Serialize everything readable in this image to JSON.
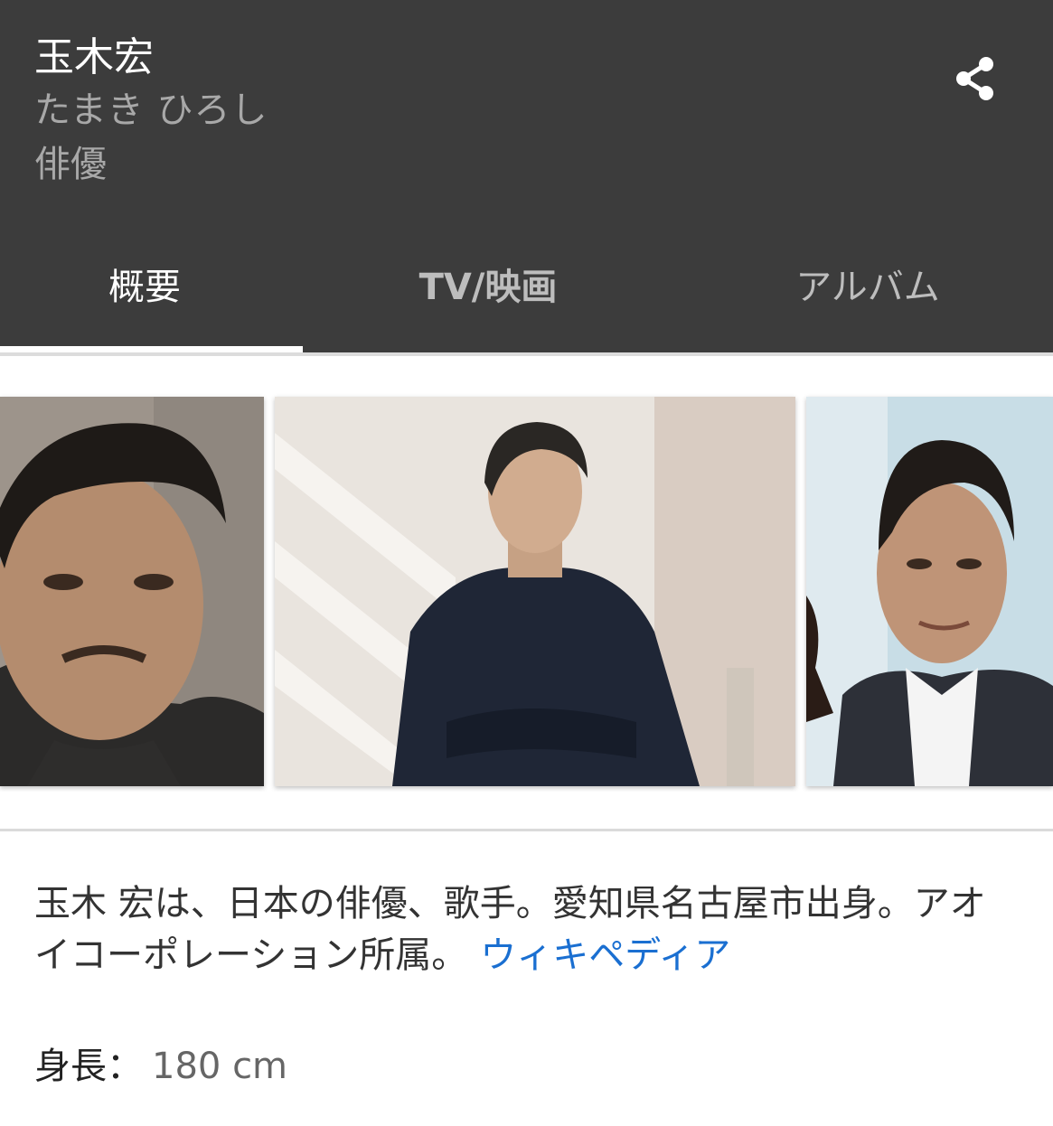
{
  "header": {
    "name": "玉木宏",
    "reading": "たまき ひろし",
    "occupation": "俳優",
    "share_icon": "share-icon"
  },
  "tabs": [
    {
      "label": "概要",
      "active": true
    },
    {
      "label": "TV/映画",
      "active": false
    },
    {
      "label": "アルバム",
      "active": false
    }
  ],
  "photos": [
    {
      "icon": "portrait-photo",
      "description": "head shot in dark turtleneck"
    },
    {
      "icon": "portrait-photo",
      "description": "seated in navy sweater, arms crossed"
    },
    {
      "icon": "portrait-photo",
      "description": "smiling in suit and white shirt"
    }
  ],
  "summary": {
    "text": "玉木 宏は、日本の俳優、歌手。愛知県名古屋市出身。アオイコーポレーション所属。",
    "source_link": "ウィキペディア"
  },
  "facts": [
    {
      "label": "身長：",
      "value": "180 cm"
    }
  ],
  "colors": {
    "header_bg": "#3c3c3c",
    "link": "#1a6fd1",
    "active_tab": "#ffffff",
    "inactive_tab": "#bdbdbd"
  }
}
